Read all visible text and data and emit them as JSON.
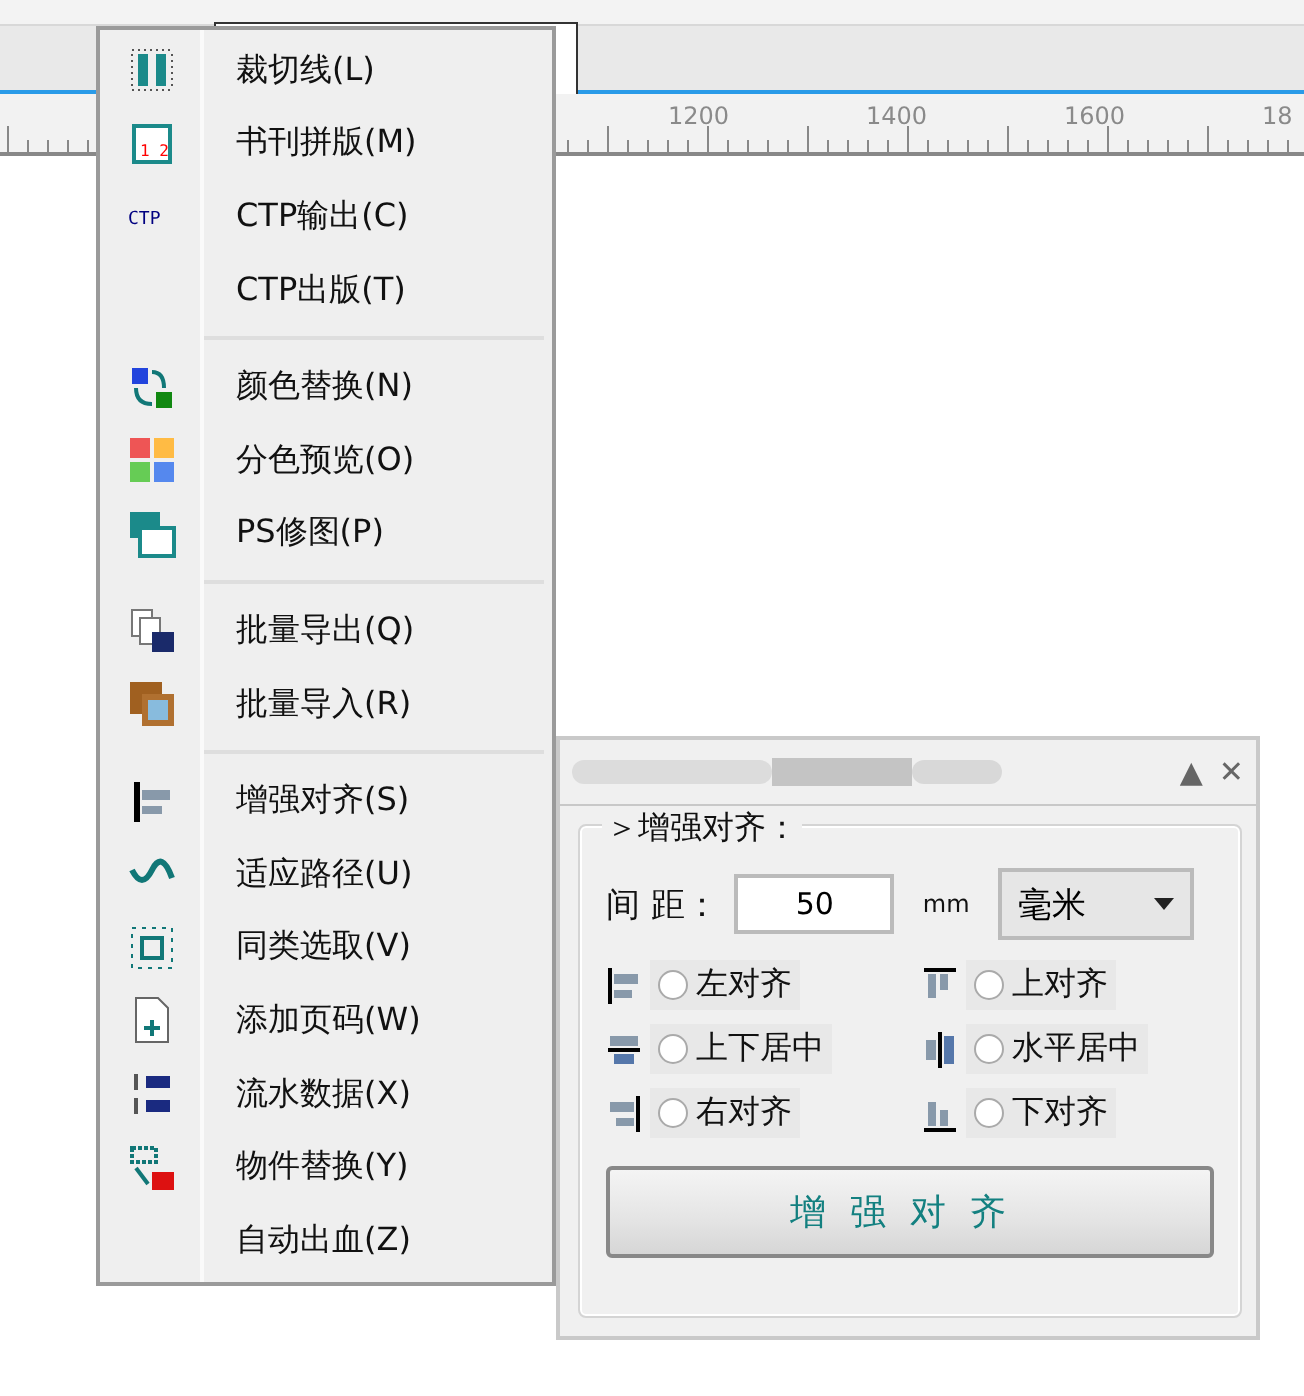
{
  "ruler": {
    "labels": [
      "1200",
      "1400",
      "1600",
      "18"
    ]
  },
  "menu": {
    "groups": [
      {
        "items": [
          {
            "label": "裁切线(L)"
          },
          {
            "label": "书刊拼版(M)",
            "icon_text": "1 2"
          },
          {
            "label": "CTP输出(C)",
            "icon_text": "CTP"
          },
          {
            "label": "CTP出版(T)"
          }
        ]
      },
      {
        "items": [
          {
            "label": "颜色替换(N)"
          },
          {
            "label": "分色预览(O)"
          },
          {
            "label": "PS修图(P)"
          }
        ]
      },
      {
        "items": [
          {
            "label": "批量导出(Q)"
          },
          {
            "label": "批量导入(R)"
          }
        ]
      },
      {
        "items": [
          {
            "label": "增强对齐(S)"
          },
          {
            "label": "适应路径(U)"
          },
          {
            "label": "同类选取(V)"
          },
          {
            "label": "添加页码(W)"
          },
          {
            "label": "流水数据(X)"
          },
          {
            "label": "物件替换(Y)"
          },
          {
            "label": "自动出血(Z)"
          }
        ]
      }
    ]
  },
  "panel": {
    "collapse": "▲",
    "close": "✕",
    "section": "＞增强对齐：",
    "spacing_label": "间 距：",
    "spacing_value": "50",
    "unit": "mm",
    "unit_select": "毫米",
    "options": [
      {
        "label": "左对齐",
        "selected": false
      },
      {
        "label": "上对齐",
        "selected": false
      },
      {
        "label": "上下居中",
        "selected": false
      },
      {
        "label": "水平居中",
        "selected": false
      },
      {
        "label": "右对齐",
        "selected": false
      },
      {
        "label": "下对齐",
        "selected": false
      }
    ],
    "button": "增强对齐"
  }
}
